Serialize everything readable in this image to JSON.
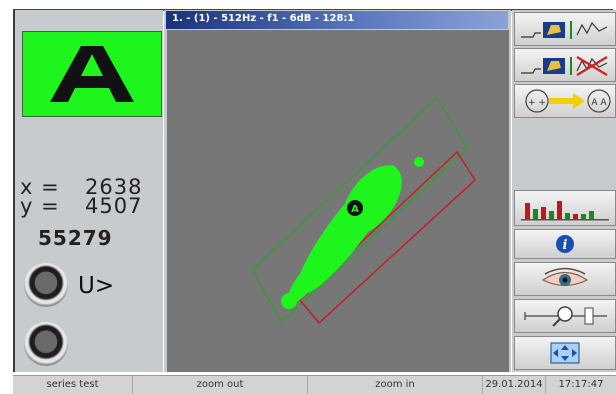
{
  "plot_window": {
    "title": "1. - (1) - 512Hz - f1 - 6dB - 128:1"
  },
  "quality_indicator": {
    "letter": "A",
    "color": "#1df51d"
  },
  "coordinates": {
    "x_label": "x =",
    "x_value": "2638",
    "y_label": "y =",
    "y_value": "4507"
  },
  "counter": "55279",
  "threshold_label": "U>",
  "plot": {
    "cluster_color": "#1df51d",
    "upper_box_color": "#3a9a3a",
    "lower_box_color": "#c02020",
    "marker_letter": "A"
  },
  "toolbar": {
    "buttons": [
      {
        "icon": "waveform-tool-icon"
      },
      {
        "icon": "clear-waveform-icon"
      },
      {
        "icon": "transfer-pattern-icon"
      },
      {
        "icon": "bar-chart-icon"
      },
      {
        "icon": "info-icon"
      },
      {
        "icon": "eye-icon"
      },
      {
        "icon": "zoom-slider-icon"
      },
      {
        "icon": "fit-view-icon"
      }
    ]
  },
  "status_bar": {
    "series": "series test",
    "zoom_out": "zoom out",
    "zoom_in": "zoom in",
    "date": "29.01.2014",
    "time": "17:17:47"
  }
}
